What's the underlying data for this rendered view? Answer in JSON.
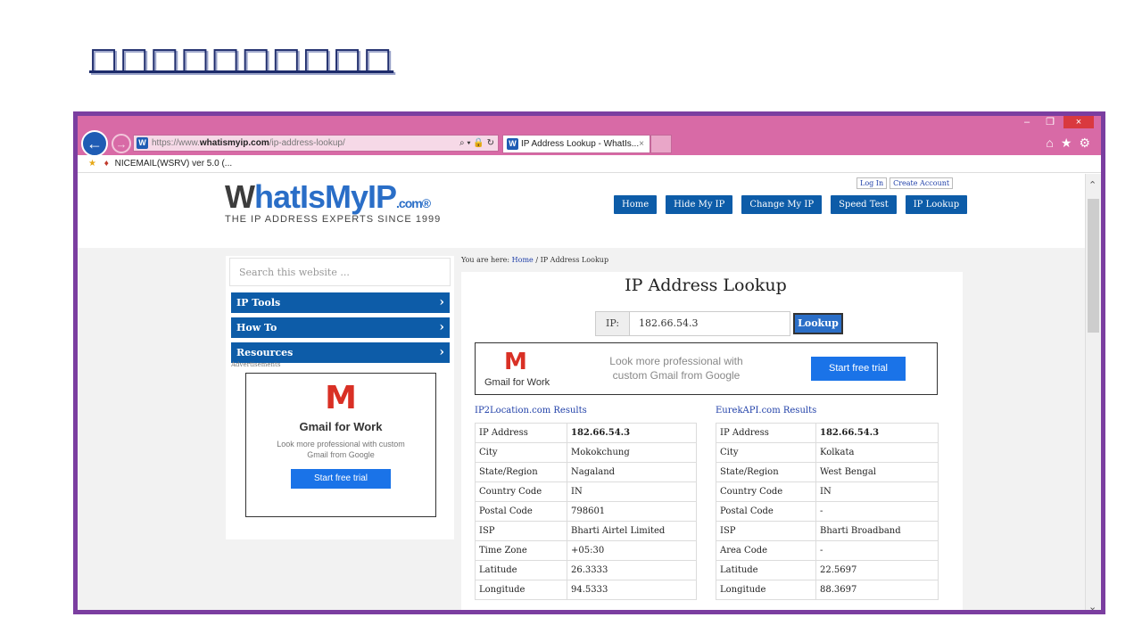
{
  "slide": {
    "title": "□□□□□□□□□□"
  },
  "browser": {
    "window_controls": [
      "–",
      "❐",
      "×"
    ],
    "url_prefix": "https://www.",
    "url_domain": "whatismyip.com",
    "url_path": "/ip-address-lookup/",
    "url_tools": "⌕ ▾ 🔒 ↻",
    "tab_title": "IP Address Lookup - WhatIs...",
    "tab_close": "×",
    "favorites": {
      "item": "NICEMAIL(WSRV) ver 5.0 (..."
    },
    "right_icons": [
      "⌂",
      "★",
      "⚙"
    ]
  },
  "site": {
    "logo": {
      "w": "W",
      "main": "hatIsMyIP",
      "com": ".com",
      "reg": "®",
      "tagline": "THE IP ADDRESS EXPERTS SINCE 1999"
    },
    "login": "Log In",
    "create_account": "Create Account",
    "nav": [
      "Home",
      "Hide My IP",
      "Change My IP",
      "Speed Test",
      "IP Lookup"
    ]
  },
  "sidebar": {
    "search_placeholder": "Search this website ...",
    "items": [
      "IP Tools",
      "How To",
      "Resources"
    ],
    "ads_label": "Advertisements",
    "ad": {
      "title": "Gmail for Work",
      "subtitle": "Look more professional with custom Gmail from Google",
      "button": "Start free trial"
    }
  },
  "main": {
    "breadcrumb": {
      "prefix": "You are here:",
      "home": "Home",
      "sep": "/",
      "current": "IP Address Lookup"
    },
    "heading": "IP Address Lookup",
    "ip_label": "IP:",
    "ip_value": "182.66.54.3",
    "lookup_button": "Lookup",
    "banner": {
      "brand": "Gmail for Work",
      "text": "Look more professional with custom Gmail from Google",
      "button": "Start free trial"
    },
    "left_results": {
      "title": "IP2Location.com Results",
      "rows": [
        [
          "IP Address",
          "182.66.54.3"
        ],
        [
          "City",
          "Mokokchung"
        ],
        [
          "State/Region",
          "Nagaland"
        ],
        [
          "Country Code",
          "IN"
        ],
        [
          "Postal Code",
          "798601"
        ],
        [
          "ISP",
          "Bharti Airtel Limited"
        ],
        [
          "Time Zone",
          "+05:30"
        ],
        [
          "Latitude",
          "26.3333"
        ],
        [
          "Longitude",
          "94.5333"
        ]
      ]
    },
    "right_results": {
      "title": "EurekAPI.com Results",
      "rows": [
        [
          "IP Address",
          "182.66.54.3"
        ],
        [
          "City",
          "Kolkata"
        ],
        [
          "State/Region",
          "West Bengal"
        ],
        [
          "Country Code",
          "IN"
        ],
        [
          "Postal Code",
          "-"
        ],
        [
          "ISP",
          "Bharti Broadband"
        ],
        [
          "Area Code",
          "-"
        ],
        [
          "Latitude",
          "22.5697"
        ],
        [
          "Longitude",
          "88.3697"
        ]
      ]
    }
  },
  "colors": {
    "frame": "#7b3ea0",
    "chrome": "#d86aa6",
    "nav_blue": "#0d5ca8",
    "link": "#1f3fa8",
    "cta": "#1a73e8"
  }
}
